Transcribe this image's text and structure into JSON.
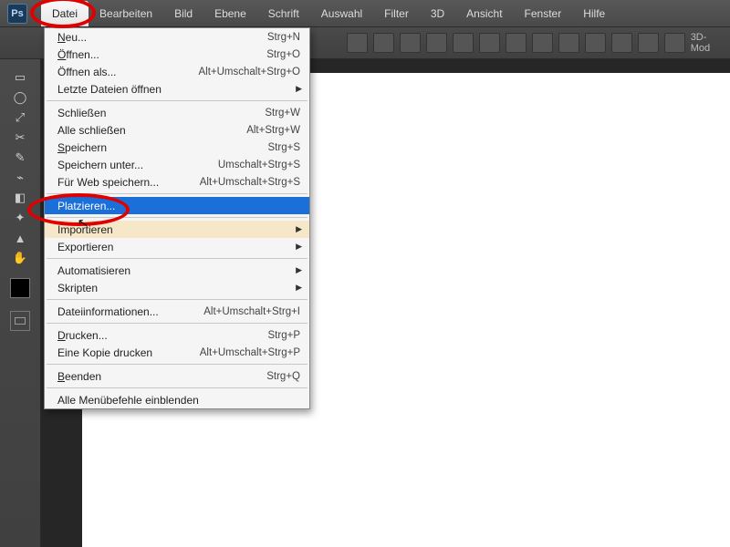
{
  "app": {
    "icon": "Ps"
  },
  "menubar": {
    "items": [
      "Datei",
      "Bearbeiten",
      "Bild",
      "Ebene",
      "Schrift",
      "Auswahl",
      "Filter",
      "3D",
      "Ansicht",
      "Fenster",
      "Hilfe"
    ]
  },
  "optionbar": {
    "mode_label": "3D-Mod"
  },
  "dropdown": {
    "groups": [
      [
        {
          "label": "Neu...",
          "shortcut": "Strg+N",
          "first_underline": true
        },
        {
          "label": "Öffnen...",
          "shortcut": "Strg+O",
          "first_underline": true
        },
        {
          "label": "Öffnen als...",
          "shortcut": "Alt+Umschalt+Strg+O"
        },
        {
          "label": "Letzte Dateien öffnen",
          "submenu": true
        }
      ],
      [
        {
          "label": "Schließen",
          "shortcut": "Strg+W"
        },
        {
          "label": "Alle schließen",
          "shortcut": "Alt+Strg+W"
        },
        {
          "label": "Speichern",
          "shortcut": "Strg+S",
          "first_underline": true
        },
        {
          "label": "Speichern unter...",
          "shortcut": "Umschalt+Strg+S"
        },
        {
          "label": "Für Web speichern...",
          "shortcut": "Alt+Umschalt+Strg+S"
        }
      ],
      [
        {
          "label": "Platzieren...",
          "selected": true
        }
      ],
      [
        {
          "label": "Importieren",
          "submenu": true,
          "hover2": true
        },
        {
          "label": "Exportieren",
          "submenu": true
        }
      ],
      [
        {
          "label": "Automatisieren",
          "submenu": true
        },
        {
          "label": "Skripten",
          "submenu": true
        }
      ],
      [
        {
          "label": "Dateiinformationen...",
          "shortcut": "Alt+Umschalt+Strg+I"
        }
      ],
      [
        {
          "label": "Drucken...",
          "shortcut": "Strg+P",
          "first_underline": true
        },
        {
          "label": "Eine Kopie drucken",
          "shortcut": "Alt+Umschalt+Strg+P"
        }
      ],
      [
        {
          "label": "Beenden",
          "shortcut": "Strg+Q",
          "first_underline": true
        }
      ],
      [
        {
          "label": "Alle Menübefehle einblenden"
        }
      ]
    ]
  },
  "tools": [
    "▭",
    "◯",
    "⤢",
    "✂",
    "✎",
    "⌁",
    "◧",
    "✦",
    "▲",
    "✋"
  ],
  "annotations": {
    "highlight_menu": "Datei",
    "highlight_item": "Platzieren..."
  }
}
